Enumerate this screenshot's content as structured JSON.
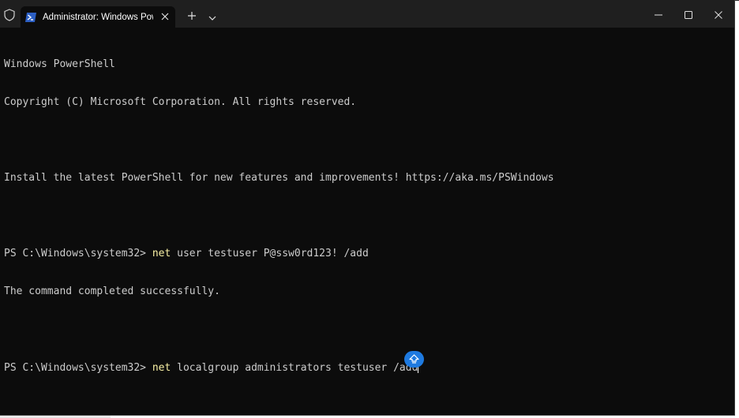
{
  "window": {
    "tab_title": "Administrator: Windows PowerShell"
  },
  "icons": {
    "shield": "shield-icon",
    "tab": "powershell-icon",
    "close_tab": "close-icon",
    "new_tab": "plus-icon",
    "dropdown": "chevron-down-icon",
    "minimize": "minimize-icon",
    "maximize": "maximize-icon",
    "close_window": "close-icon",
    "scroll": "scroll-to-bottom-icon"
  },
  "colors": {
    "terminal_bg": "#0c0c0c",
    "titlebar_bg": "#1f1f1f",
    "text": "#cccccc",
    "command": "#f9f1a5",
    "accent": "#1e7ae0"
  },
  "terminal": {
    "banner_1": "Windows PowerShell",
    "banner_2": "Copyright (C) Microsoft Corporation. All rights reserved.",
    "banner_3": "Install the latest PowerShell for new features and improvements! https://aka.ms/PSWindows",
    "prompt_1": "PS C:\\Windows\\system32> ",
    "command_1": "net",
    "args_1": " user testuser P@ssw0rd123! /add",
    "output_1": "The command completed successfully.",
    "prompt_2": "PS C:\\Windows\\system32> ",
    "command_2": "net",
    "args_2": " localgroup administrators testuser /add"
  }
}
